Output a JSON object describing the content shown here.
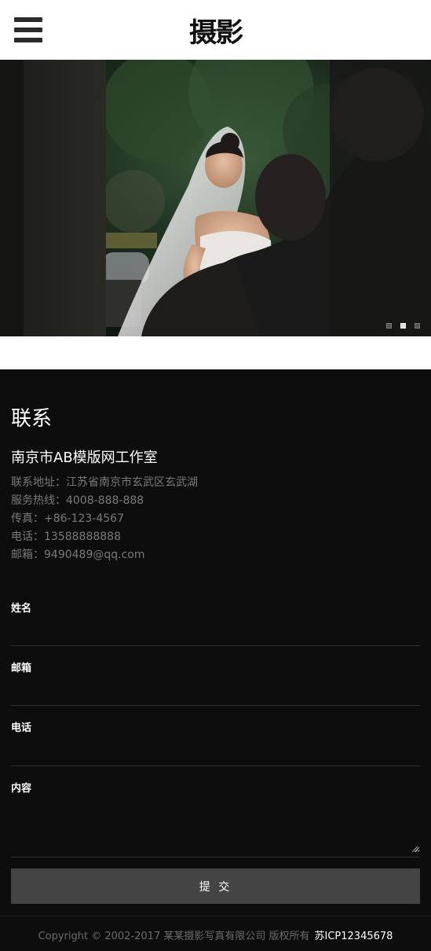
{
  "header": {
    "logo": "摄影",
    "menu_icon": "hamburger-menu-icon"
  },
  "banner": {
    "image_subject": "bride in veil",
    "slides_count": 3,
    "active_slide": 2
  },
  "contact": {
    "title": "联系",
    "company": "南京市AB模版网工作室",
    "info": {
      "address": "联系地址：江苏省南京市玄武区玄武湖",
      "hotline": "服务热线：4008-888-888",
      "fax": "传真：+86-123-4567",
      "phone": "电话：13588888888",
      "email": "邮箱：9490489@qq.com"
    },
    "form": {
      "name_label": "姓名",
      "email_label": "邮箱",
      "phone_label": "电话",
      "content_label": "内容",
      "submit_label": "提 交"
    }
  },
  "footer": {
    "copyright": "Copyright © 2002-2017 某某摄影写真有限公司 版权所有",
    "icp": "苏ICP12345678"
  },
  "colors": {
    "dark_bg": "#0d0d0d",
    "button_bg": "#444444",
    "muted_text": "#7a7a7a"
  }
}
